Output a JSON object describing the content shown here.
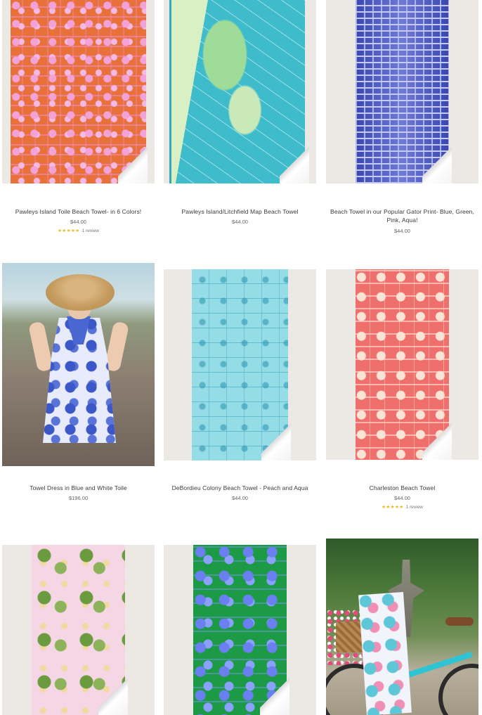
{
  "products": [
    {
      "title": "Pawleys Island Toile Beach Towel- in 6 Colors!",
      "price": "$44.00",
      "stars": "★★★★★",
      "reviews": "1 review",
      "image": "orange-pink-toile-towel"
    },
    {
      "title": "Pawleys Island/Litchfield Map Beach Towel",
      "price": "$44.00",
      "image": "aqua-map-towel"
    },
    {
      "title": "Beach Towel in our Popular Gator Print- Blue, Green, Pink, Aqua!",
      "price": "$44.00",
      "image": "blue-gator-print-towel"
    },
    {
      "title": "Towel Dress in Blue and White Toile",
      "price": "$196.00",
      "image": "woman-in-toile-dress-photo"
    },
    {
      "title": "DeBordieu Colony Beach Towel - Peach and Aqua",
      "price": "$44.00",
      "image": "aqua-toile-towel"
    },
    {
      "title": "Charleston Beach Towel",
      "price": "$44.00",
      "stars": "★★★★★",
      "reviews": "1 review",
      "image": "coral-charleston-towel"
    },
    {
      "image": "pink-palm-towel"
    },
    {
      "image": "green-blue-toile-towel"
    },
    {
      "image": "towel-on-bicycle-photo"
    }
  ]
}
